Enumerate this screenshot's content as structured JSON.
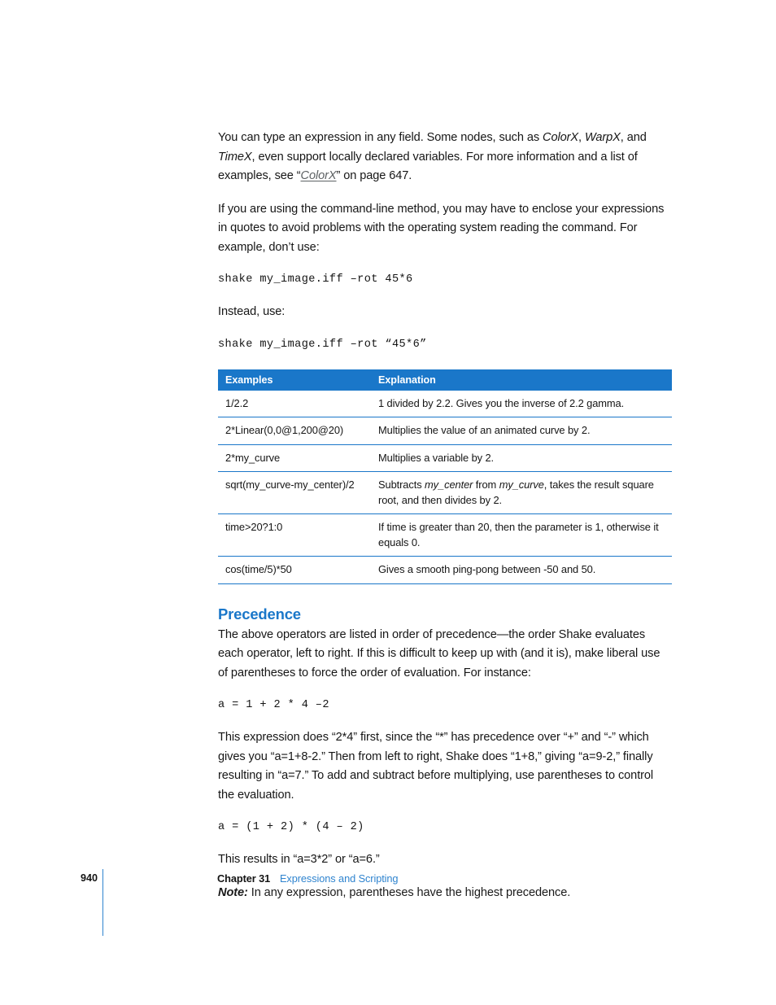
{
  "page": {
    "number": "940",
    "chapter_label": "Chapter 31",
    "chapter_title": "Expressions and Scripting"
  },
  "paragraphs": {
    "p1_part1": "You can type an expression in any field. Some nodes, such as ",
    "p1_italic1": "ColorX",
    "p1_part2": ", ",
    "p1_italic2": "WarpX",
    "p1_part3": ", and ",
    "p1_italic3": "TimeX",
    "p1_part4": ", even support locally declared variables. For more information and a list of examples, see “",
    "p1_link": "ColorX",
    "p1_part5": "” on page 647.",
    "p2": "If you are using the command-line method, you may have to enclose your expressions in quotes to avoid problems with the operating system reading the command. For example, don’t use:",
    "code1": "shake my_image.iff –rot 45*6",
    "p3": "Instead, use:",
    "code2": "shake my_image.iff –rot “45*6”"
  },
  "table": {
    "headers": {
      "col1": "Examples",
      "col2": "Explanation"
    },
    "rows": [
      {
        "example": "1/2.2",
        "explanation_pre": "1 divided by 2.2. Gives you the inverse of 2.2 gamma.",
        "explanation_italic": "",
        "explanation_mid": "",
        "explanation_italic2": "",
        "explanation_post": ""
      },
      {
        "example": "2*Linear(0,0@1,200@20)",
        "explanation_pre": "Multiplies the value of an animated curve by 2.",
        "explanation_italic": "",
        "explanation_mid": "",
        "explanation_italic2": "",
        "explanation_post": ""
      },
      {
        "example": "2*my_curve",
        "explanation_pre": "Multiplies a variable by 2.",
        "explanation_italic": "",
        "explanation_mid": "",
        "explanation_italic2": "",
        "explanation_post": ""
      },
      {
        "example": "sqrt(my_curve-my_center)/2",
        "explanation_pre": "Subtracts ",
        "explanation_italic": "my_center",
        "explanation_mid": " from ",
        "explanation_italic2": "my_curve",
        "explanation_post": ", takes the result square root, and then divides by 2."
      },
      {
        "example": "time>20?1:0",
        "explanation_pre": "If time is greater than 20, then the parameter is 1, otherwise it equals 0.",
        "explanation_italic": "",
        "explanation_mid": "",
        "explanation_italic2": "",
        "explanation_post": ""
      },
      {
        "example": "cos(time/5)*50",
        "explanation_pre": "Gives a smooth ping-pong between -50 and 50.",
        "explanation_italic": "",
        "explanation_mid": "",
        "explanation_italic2": "",
        "explanation_post": ""
      }
    ]
  },
  "precedence": {
    "heading": "Precedence",
    "p1": "The above operators are listed in order of precedence—the order Shake evaluates each operator, left to right. If this is difficult to keep up with (and it is), make liberal use of parentheses to force the order of evaluation. For instance:",
    "code1": "a = 1 + 2 * 4 –2",
    "p2": "This expression does “2*4” first, since the “*” has precedence over “+” and “-” which gives you “a=1+8-2.” Then from left to right, Shake does “1+8,” giving “a=9-2,” finally resulting in “a=7.” To add and subtract before multiplying, use parentheses to control the evaluation.",
    "code2": "a = (1 + 2) * (4 – 2)",
    "p3": "This results in “a=3*2” or “a=6.”",
    "note_label": "Note:",
    "note_text": " In any expression, parentheses have the highest precedence."
  },
  "colors": {
    "accent_blue": "#1a77c9",
    "footer_link_blue": "#2f84cf",
    "link_gray": "#5d6163",
    "text": "#161616"
  }
}
